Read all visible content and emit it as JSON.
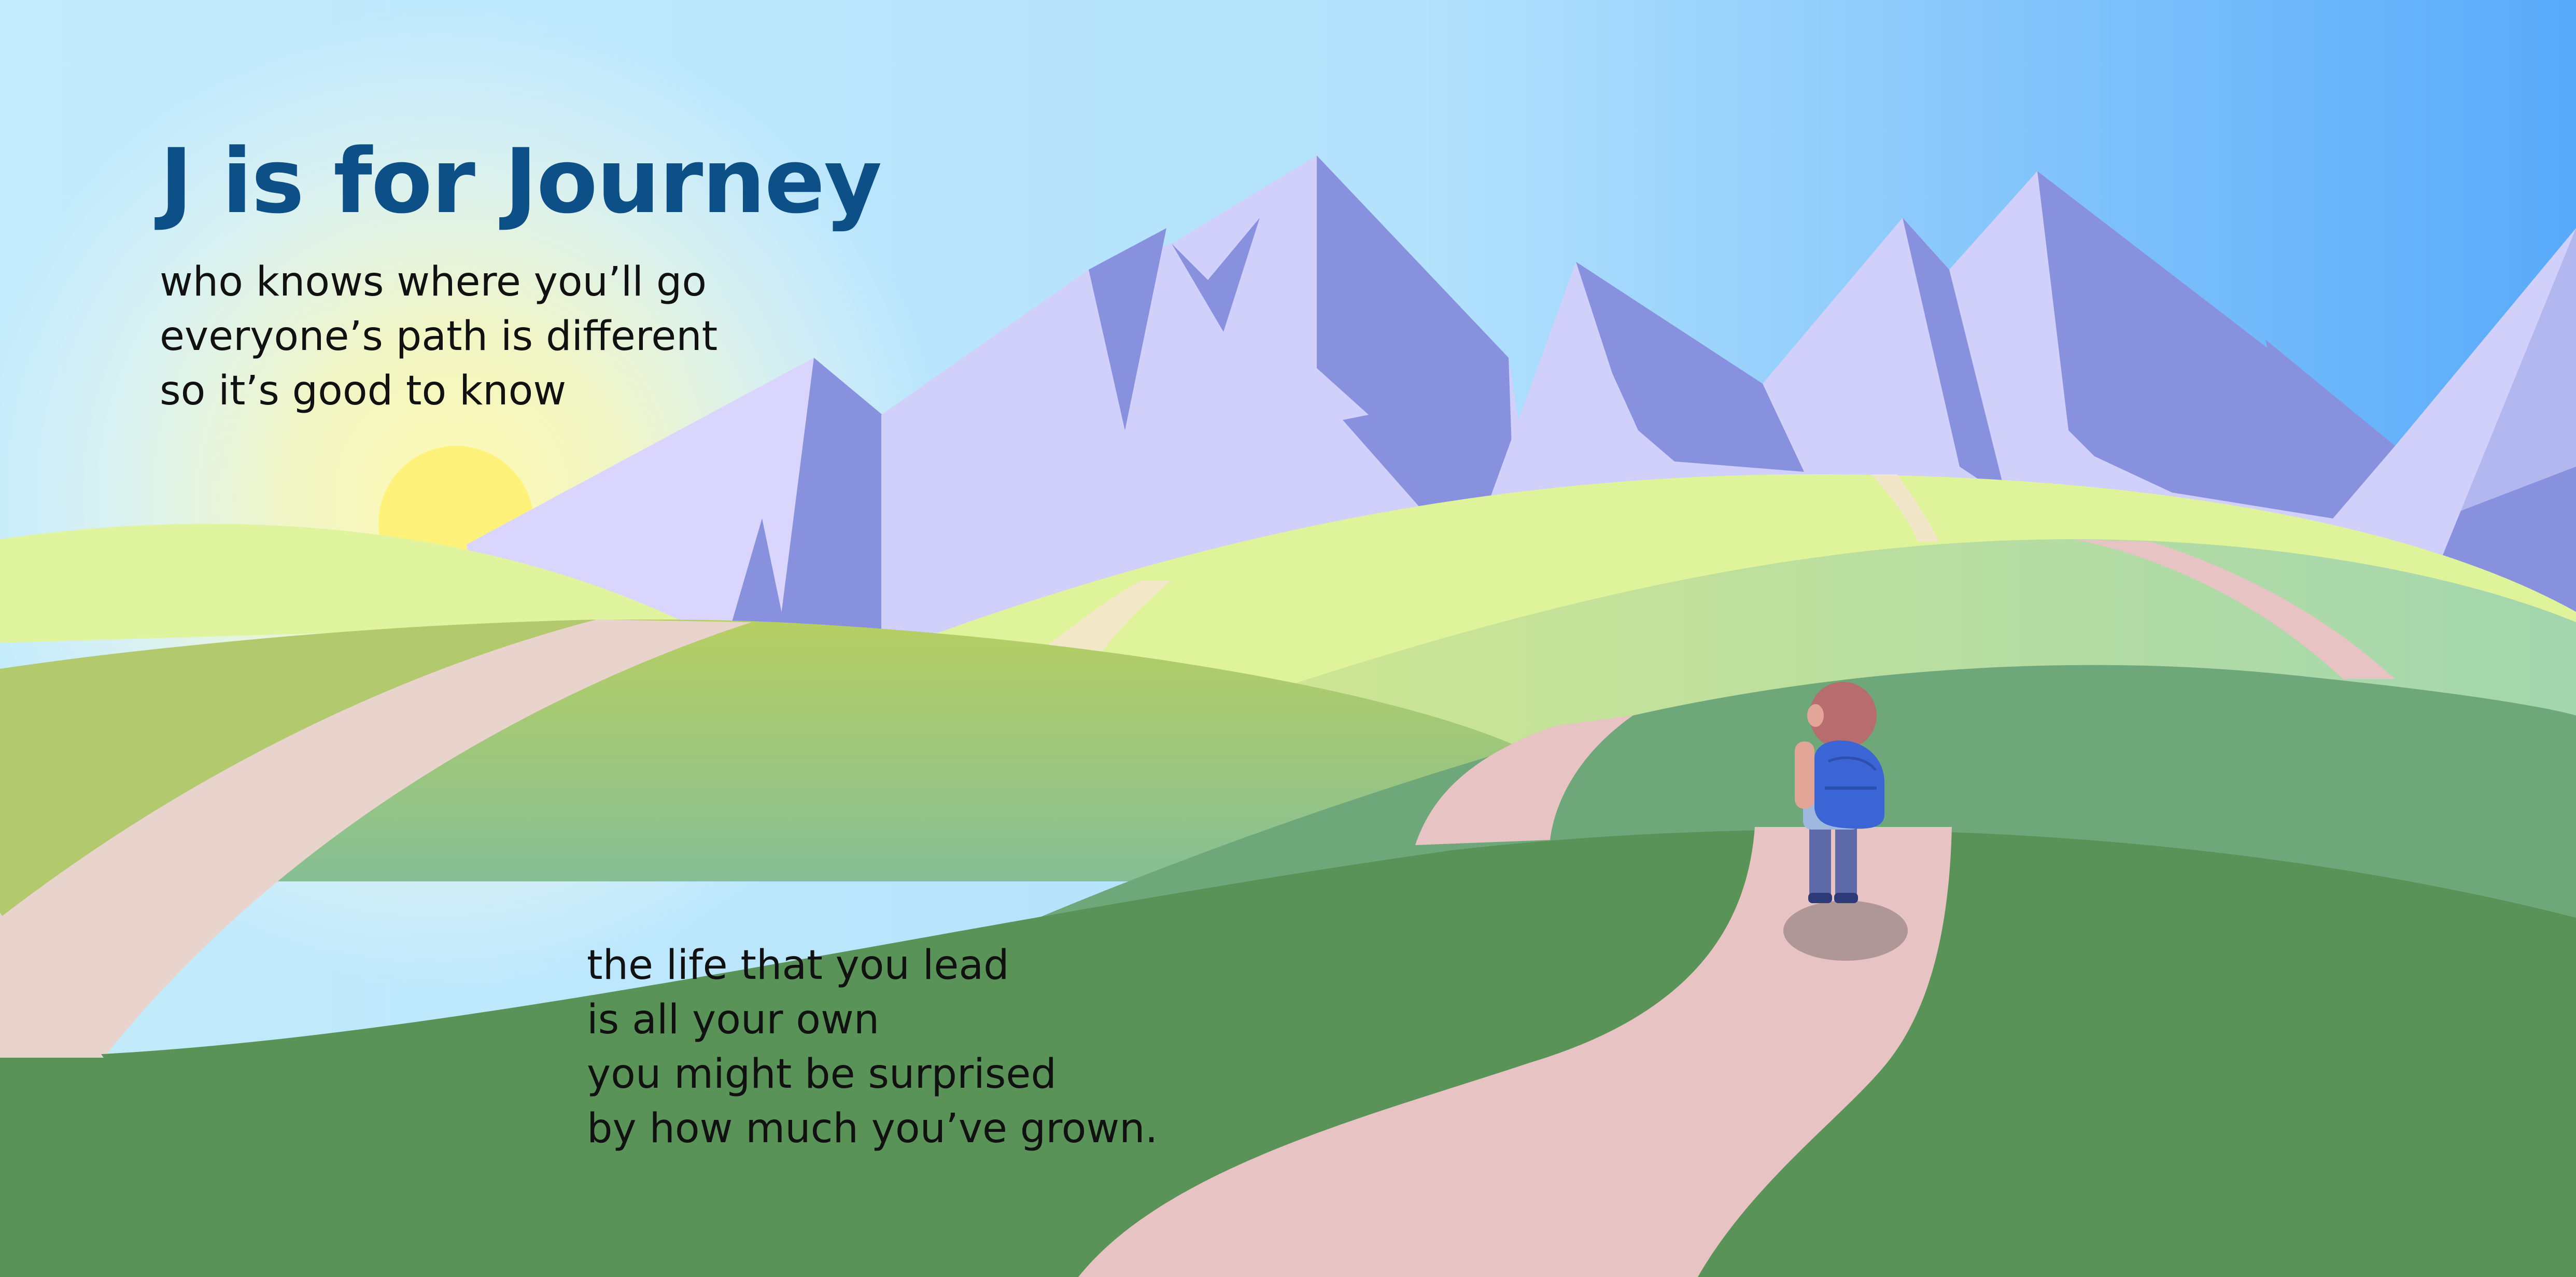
{
  "page": {
    "title": "J is for Journey",
    "verse_top": [
      "who knows where you’ll go",
      "everyone’s path is different",
      "so it’s good to know"
    ],
    "verse_bottom": [
      "the life that you lead",
      "is all your own",
      "you might be surprised",
      "by how much you’ve grown."
    ]
  },
  "colors": {
    "sky_light": "#c6ecfb",
    "sky_blue": "#5aaefa",
    "sun": "#fff27a",
    "mountain_light": "#d3d2fb",
    "mountain_shadow": "#8891de",
    "hill_lime": "#def39a",
    "hill_mid": "#9fca83",
    "hill_dark": "#6ea87a",
    "hill_darkest": "#5a9358",
    "path": "#e8c3c3",
    "title": "#0d4f87",
    "backpack": "#3b64d4"
  },
  "illustration": {
    "elements": [
      "sun",
      "mountains",
      "hills",
      "path",
      "child-hiker",
      "backpack"
    ]
  }
}
